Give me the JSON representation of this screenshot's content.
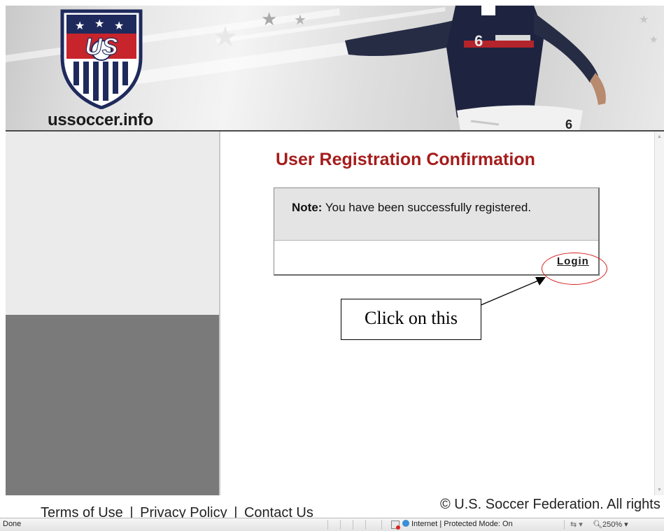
{
  "header": {
    "site_name": "ussoccer.info",
    "crest_text": "US",
    "player_number": "6"
  },
  "main": {
    "title": "User Registration Confirmation",
    "note_label": "Note:",
    "note_message": "You have been successfully registered.",
    "login_link": "Login"
  },
  "annotation": {
    "text": "Click on this"
  },
  "footer": {
    "links": [
      "Terms of Use",
      "Privacy Policy",
      "Contact Us"
    ],
    "separator": "|",
    "copyright": "© U.S. Soccer Federation. All rights"
  },
  "statusbar": {
    "status": "Done",
    "zone": "Internet | Protected Mode: On",
    "zoom": "250%"
  },
  "colors": {
    "title_red": "#a51c1c",
    "annotation_red": "#d62020"
  }
}
